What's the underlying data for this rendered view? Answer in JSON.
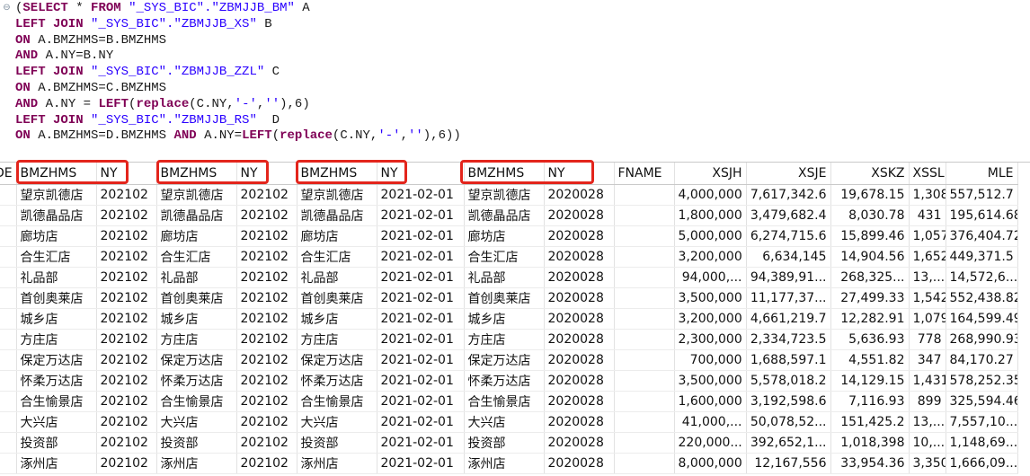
{
  "sql": {
    "fold_icon": "collapse-icon",
    "lines": [
      [
        [
          "plain",
          "("
        ],
        [
          "kw",
          "SELECT"
        ],
        [
          "plain",
          " * "
        ],
        [
          "kw",
          "FROM"
        ],
        [
          "plain",
          " "
        ],
        [
          "str",
          "\"_SYS_BIC\".\"ZBMJJB_BM\""
        ],
        [
          "plain",
          " A"
        ]
      ],
      [
        [
          "kw",
          "LEFT JOIN"
        ],
        [
          "plain",
          " "
        ],
        [
          "str",
          "\"_SYS_BIC\".\"ZBMJJB_XS\""
        ],
        [
          "plain",
          " B"
        ]
      ],
      [
        [
          "kw",
          "ON"
        ],
        [
          "plain",
          " A.BMZHMS=B.BMZHMS"
        ]
      ],
      [
        [
          "kw",
          "AND"
        ],
        [
          "plain",
          " A.NY=B.NY"
        ]
      ],
      [
        [
          "kw",
          "LEFT JOIN"
        ],
        [
          "plain",
          " "
        ],
        [
          "str",
          "\"_SYS_BIC\".\"ZBMJJB_ZZL\""
        ],
        [
          "plain",
          " C"
        ]
      ],
      [
        [
          "kw",
          "ON"
        ],
        [
          "plain",
          " A.BMZHMS=C.BMZHMS"
        ]
      ],
      [
        [
          "kw",
          "AND"
        ],
        [
          "plain",
          " A.NY = "
        ],
        [
          "fn",
          "LEFT"
        ],
        [
          "plain",
          "("
        ],
        [
          "fn",
          "replace"
        ],
        [
          "plain",
          "(C.NY,"
        ],
        [
          "str",
          "'-'"
        ],
        [
          "plain",
          ","
        ],
        [
          "str",
          "''"
        ],
        [
          "plain",
          "),6)"
        ]
      ],
      [
        [
          "kw",
          "LEFT JOIN"
        ],
        [
          "plain",
          " "
        ],
        [
          "str",
          "\"_SYS_BIC\".\"ZBMJJB_RS\""
        ],
        [
          "plain",
          "  D"
        ]
      ],
      [
        [
          "kw",
          "ON"
        ],
        [
          "plain",
          " A.BMZHMS=D.BMZHMS "
        ],
        [
          "kw",
          "AND"
        ],
        [
          "plain",
          " A.NY="
        ],
        [
          "fn",
          "LEFT"
        ],
        [
          "plain",
          "("
        ],
        [
          "fn",
          "replace"
        ],
        [
          "plain",
          "(C.NY,"
        ],
        [
          "str",
          "'-'"
        ],
        [
          "plain",
          ","
        ],
        [
          "str",
          "''"
        ],
        [
          "plain",
          "),6))"
        ]
      ]
    ]
  },
  "grid": {
    "columns": [
      {
        "label": "DE",
        "align": "left"
      },
      {
        "label": "BMZHMS",
        "align": "left"
      },
      {
        "label": "NY",
        "align": "left"
      },
      {
        "label": "BMZHMS",
        "align": "left"
      },
      {
        "label": "NY",
        "align": "left"
      },
      {
        "label": "BMZHMS",
        "align": "left"
      },
      {
        "label": "NY",
        "align": "left"
      },
      {
        "label": "BMZHMS",
        "align": "left"
      },
      {
        "label": "NY",
        "align": "left"
      },
      {
        "label": "FNAME",
        "align": "left"
      },
      {
        "label": "XSJH",
        "align": "right"
      },
      {
        "label": "XSJE",
        "align": "right"
      },
      {
        "label": "XSKZ",
        "align": "right"
      },
      {
        "label": "XSSL",
        "align": "right"
      },
      {
        "label": "MLE",
        "align": "right"
      }
    ],
    "rows": [
      [
        "",
        "望京凯德店",
        "202102",
        "望京凯德店",
        "202102",
        "望京凯德店",
        "2021-02-01",
        "望京凯德店",
        "2020028",
        "",
        "4,000,000",
        "7,617,342.6",
        "19,678.15",
        "1,308",
        "557,512.7"
      ],
      [
        "",
        "凯德晶品店",
        "202102",
        "凯德晶品店",
        "202102",
        "凯德晶品店",
        "2021-02-01",
        "凯德晶品店",
        "2020028",
        "",
        "1,800,000",
        "3,479,682.4",
        "8,030.78",
        "431",
        "195,614.68"
      ],
      [
        "",
        "廊坊店",
        "202102",
        "廊坊店",
        "202102",
        "廊坊店",
        "2021-02-01",
        "廊坊店",
        "2020028",
        "",
        "5,000,000",
        "6,274,715.6",
        "15,899.46",
        "1,057",
        "376,404.72"
      ],
      [
        "",
        "合生汇店",
        "202102",
        "合生汇店",
        "202102",
        "合生汇店",
        "2021-02-01",
        "合生汇店",
        "2020028",
        "",
        "3,200,000",
        "6,634,145",
        "14,904.56",
        "1,652",
        "449,371.5"
      ],
      [
        "",
        "礼品部",
        "202102",
        "礼品部",
        "202102",
        "礼品部",
        "2021-02-01",
        "礼品部",
        "2020028",
        "",
        "94,000,...",
        "94,389,91...",
        "268,325...",
        "13,...",
        "14,572,6..."
      ],
      [
        "",
        "首创奥莱店",
        "202102",
        "首创奥莱店",
        "202102",
        "首创奥莱店",
        "2021-02-01",
        "首创奥莱店",
        "2020028",
        "",
        "3,500,000",
        "11,177,37...",
        "27,499.33",
        "1,542",
        "552,438.82"
      ],
      [
        "",
        "城乡店",
        "202102",
        "城乡店",
        "202102",
        "城乡店",
        "2021-02-01",
        "城乡店",
        "2020028",
        "",
        "3,200,000",
        "4,661,219.7",
        "12,282.91",
        "1,079",
        "164,599.49"
      ],
      [
        "",
        "方庄店",
        "202102",
        "方庄店",
        "202102",
        "方庄店",
        "2021-02-01",
        "方庄店",
        "2020028",
        "",
        "2,300,000",
        "2,334,723.5",
        "5,636.93",
        "778",
        "268,990.93"
      ],
      [
        "",
        "保定万达店",
        "202102",
        "保定万达店",
        "202102",
        "保定万达店",
        "2021-02-01",
        "保定万达店",
        "2020028",
        "",
        "700,000",
        "1,688,597.1",
        "4,551.82",
        "347",
        "84,170.27"
      ],
      [
        "",
        "怀柔万达店",
        "202102",
        "怀柔万达店",
        "202102",
        "怀柔万达店",
        "2021-02-01",
        "怀柔万达店",
        "2020028",
        "",
        "3,500,000",
        "5,578,018.2",
        "14,129.15",
        "1,431",
        "578,252.35"
      ],
      [
        "",
        "合生愉景店",
        "202102",
        "合生愉景店",
        "202102",
        "合生愉景店",
        "2021-02-01",
        "合生愉景店",
        "2020028",
        "",
        "1,600,000",
        "3,192,598.6",
        "7,116.93",
        "899",
        "325,594.46"
      ],
      [
        "",
        "大兴店",
        "202102",
        "大兴店",
        "202102",
        "大兴店",
        "2021-02-01",
        "大兴店",
        "2020028",
        "",
        "41,000,...",
        "50,078,52...",
        "151,425.2",
        "13,...",
        "7,557,10..."
      ],
      [
        "",
        "投资部",
        "202102",
        "投资部",
        "202102",
        "投资部",
        "2021-02-01",
        "投资部",
        "2020028",
        "",
        "220,000...",
        "392,652,1...",
        "1,018,398",
        "10,...",
        "1,148,69..."
      ],
      [
        "",
        "涿州店",
        "202102",
        "涿州店",
        "202102",
        "涿州店",
        "2021-02-01",
        "涿州店",
        "2020028",
        "",
        "8,000,000",
        "12,167,556",
        "33,954.36",
        "3,350",
        "1,666,09..."
      ]
    ]
  },
  "highlight_color": "#e3251c"
}
